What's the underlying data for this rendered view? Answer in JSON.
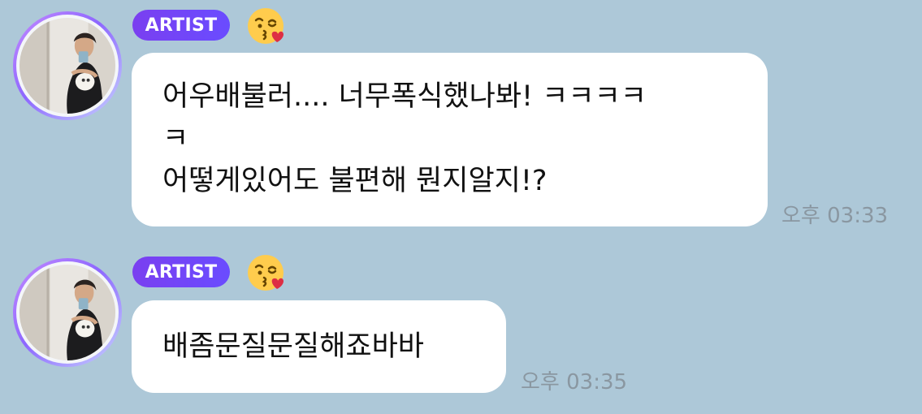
{
  "background_color": "#adc8d8",
  "badge_gradient": [
    "#7a3ff0",
    "#6a4cff"
  ],
  "messages": [
    {
      "badge_label": "ARTIST",
      "emoji_icon": "kissing-face-with-heart-icon",
      "lines": [
        "어우배불러.... 너무폭식했나봐! ㅋㅋㅋㅋ",
        "ㅋ",
        "어떻게있어도 불편해 뭔지알지!?"
      ],
      "time": "오후 03:33"
    },
    {
      "badge_label": "ARTIST",
      "emoji_icon": "kissing-face-with-heart-icon",
      "lines": [
        "배좀문질문질해죠바바"
      ],
      "time": "오후 03:35"
    }
  ]
}
